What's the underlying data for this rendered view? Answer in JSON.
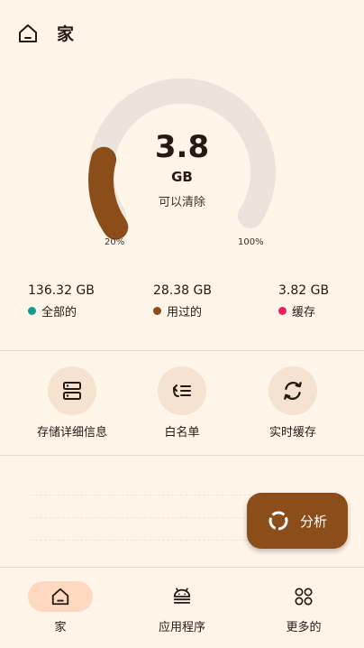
{
  "header": {
    "title": "家",
    "icon": "home-icon"
  },
  "storage": {
    "cleanable_value": "3.8",
    "cleanable_unit": "GB",
    "cleanable_label": "可以清除",
    "gauge_fraction": 0.2,
    "min_label": "20%",
    "max_label": "100%",
    "colors": {
      "track": "#ece4da",
      "fill": "#8b4d1a"
    }
  },
  "stats": [
    {
      "value": "136.32 GB",
      "label": "全部的",
      "color": "#129e8a"
    },
    {
      "value": "28.38 GB",
      "label": "用过的",
      "color": "#8b4d1a"
    },
    {
      "value": "3.82 GB",
      "label": "缓存",
      "color": "#e8225f"
    }
  ],
  "actions": [
    {
      "label": "存储详细信息",
      "icon": "storage-icon"
    },
    {
      "label": "白名单",
      "icon": "whitelist-icon"
    },
    {
      "label": "实时缓存",
      "icon": "refresh-icon"
    }
  ],
  "fab": {
    "label": "分析",
    "icon": "progress-ring-icon"
  },
  "nav": [
    {
      "label": "家",
      "icon": "home-icon",
      "active": true
    },
    {
      "label": "应用程序",
      "icon": "android-icon",
      "active": false
    },
    {
      "label": "更多的",
      "icon": "grid-circles-icon",
      "active": false
    }
  ]
}
